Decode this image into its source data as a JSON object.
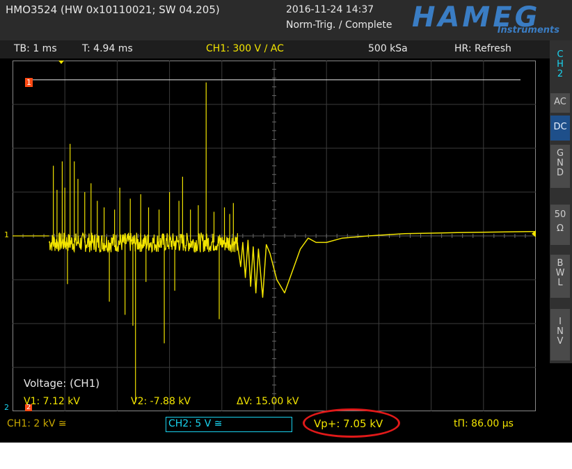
{
  "header": {
    "device": "HMO3524 (HW 0x10110021; SW 04.205)",
    "datetime": "2016-11-24 14:37",
    "trigger_state": "Norm-Trig. / Complete",
    "logo_text": "HAMEG",
    "logo_subtext": "Instruments"
  },
  "status": {
    "timebase": "TB: 1 ms",
    "trigger_time": "T: 4.94 ms",
    "channel": "CH1: 300 V ∕ AC",
    "sample_rate": "500 kSa",
    "acquisition": "HR: Refresh"
  },
  "sidebar": {
    "channel_label": [
      "C",
      "H",
      "2"
    ],
    "buttons": [
      {
        "lines": [
          "AC"
        ],
        "active": false
      },
      {
        "lines": [
          "DC"
        ],
        "active": true
      },
      {
        "lines": [
          "G",
          "N",
          "D"
        ],
        "active": false
      },
      {
        "lines": [
          "50",
          "Ω"
        ],
        "active": false
      },
      {
        "lines": [
          "B",
          "W",
          "L"
        ],
        "active": false
      },
      {
        "lines": [
          "I",
          "N",
          "V"
        ],
        "active": false
      }
    ]
  },
  "markers": {
    "cursor_marker": "1",
    "ch1_ref": "1",
    "ch2_ref": "2",
    "ch2_ref_marker": "2"
  },
  "measurement": {
    "title": "Voltage: (CH1)",
    "v1": "V1: 7.12 kV",
    "v2": "V2: -7.88 kV",
    "dv": "ΔV: 15.00 kV"
  },
  "bottom": {
    "ch1": "CH1: 2 kV ≅",
    "ch2": "CH2: 5 V ≅",
    "vp": "Vp+: 7.05 kV",
    "t": "tΠ: 86.00 µs"
  },
  "colors": {
    "trace": "#f2e400",
    "cursor": "#e8e8e8",
    "channel2": "#19d4f0",
    "highlight": "#e01919",
    "logo": "#3a7dc4"
  },
  "waveform": {
    "units": "kV",
    "volts_per_div": 2,
    "time_per_div_ms": 1,
    "time_span_ms": 10,
    "baseline_kV": 0.0,
    "cursor_v1_kV": 7.12,
    "cursor_v2_kV": -7.88,
    "noise_segment_ms": [
      0.7,
      4.3
    ],
    "noise_level_kV": -0.3,
    "spikes": [
      {
        "t": 0.78,
        "v": 3.2
      },
      {
        "t": 0.85,
        "v": 2.1
      },
      {
        "t": 0.95,
        "v": 3.4
      },
      {
        "t": 1.0,
        "v": 2.2
      },
      {
        "t": 1.05,
        "v": -2.2
      },
      {
        "t": 1.1,
        "v": 4.2
      },
      {
        "t": 1.18,
        "v": 3.4
      },
      {
        "t": 1.25,
        "v": 2.6
      },
      {
        "t": 1.38,
        "v": 2.0
      },
      {
        "t": 1.5,
        "v": 2.4
      },
      {
        "t": 1.62,
        "v": 1.6
      },
      {
        "t": 1.75,
        "v": 1.3
      },
      {
        "t": 1.85,
        "v": -3.0
      },
      {
        "t": 1.95,
        "v": 1.2
      },
      {
        "t": 2.05,
        "v": 2.2
      },
      {
        "t": 2.15,
        "v": -3.6
      },
      {
        "t": 2.25,
        "v": 1.7
      },
      {
        "t": 2.3,
        "v": -4.1
      },
      {
        "t": 2.35,
        "v": -7.6
      },
      {
        "t": 2.45,
        "v": 1.9
      },
      {
        "t": 2.55,
        "v": -2.1
      },
      {
        "t": 2.6,
        "v": 1.3
      },
      {
        "t": 2.8,
        "v": 1.2
      },
      {
        "t": 2.9,
        "v": -4.9
      },
      {
        "t": 3.0,
        "v": 2.0
      },
      {
        "t": 3.1,
        "v": -2.5
      },
      {
        "t": 3.18,
        "v": 1.6
      },
      {
        "t": 3.25,
        "v": 2.7
      },
      {
        "t": 3.4,
        "v": 1.2
      },
      {
        "t": 3.55,
        "v": 1.4
      },
      {
        "t": 3.7,
        "v": 7.0
      },
      {
        "t": 3.85,
        "v": 1.1
      },
      {
        "t": 3.95,
        "v": -3.8
      },
      {
        "t": 4.05,
        "v": 1.3
      },
      {
        "t": 4.15,
        "v": 1.0
      },
      {
        "t": 4.22,
        "v": 1.5
      }
    ],
    "ringing": [
      {
        "t": 4.3,
        "v": -0.4
      },
      {
        "t": 4.36,
        "v": -1.4
      },
      {
        "t": 4.4,
        "v": -0.3
      },
      {
        "t": 4.45,
        "v": -1.9
      },
      {
        "t": 4.5,
        "v": -0.2
      },
      {
        "t": 4.55,
        "v": -2.3
      },
      {
        "t": 4.6,
        "v": -0.5
      },
      {
        "t": 4.65,
        "v": -2.6
      },
      {
        "t": 4.7,
        "v": -0.6
      },
      {
        "t": 4.78,
        "v": -2.8
      },
      {
        "t": 4.85,
        "v": -0.4
      },
      {
        "t": 4.92,
        "v": -0.8
      },
      {
        "t": 5.05,
        "v": -2.0
      },
      {
        "t": 5.2,
        "v": -2.6
      },
      {
        "t": 5.35,
        "v": -1.6
      },
      {
        "t": 5.5,
        "v": -0.6
      },
      {
        "t": 5.65,
        "v": -0.1
      },
      {
        "t": 5.8,
        "v": -0.3
      },
      {
        "t": 6.0,
        "v": -0.3
      },
      {
        "t": 6.3,
        "v": -0.1
      },
      {
        "t": 6.8,
        "v": 0.0
      },
      {
        "t": 7.5,
        "v": 0.1
      },
      {
        "t": 8.5,
        "v": 0.15
      },
      {
        "t": 10.0,
        "v": 0.2
      }
    ]
  }
}
